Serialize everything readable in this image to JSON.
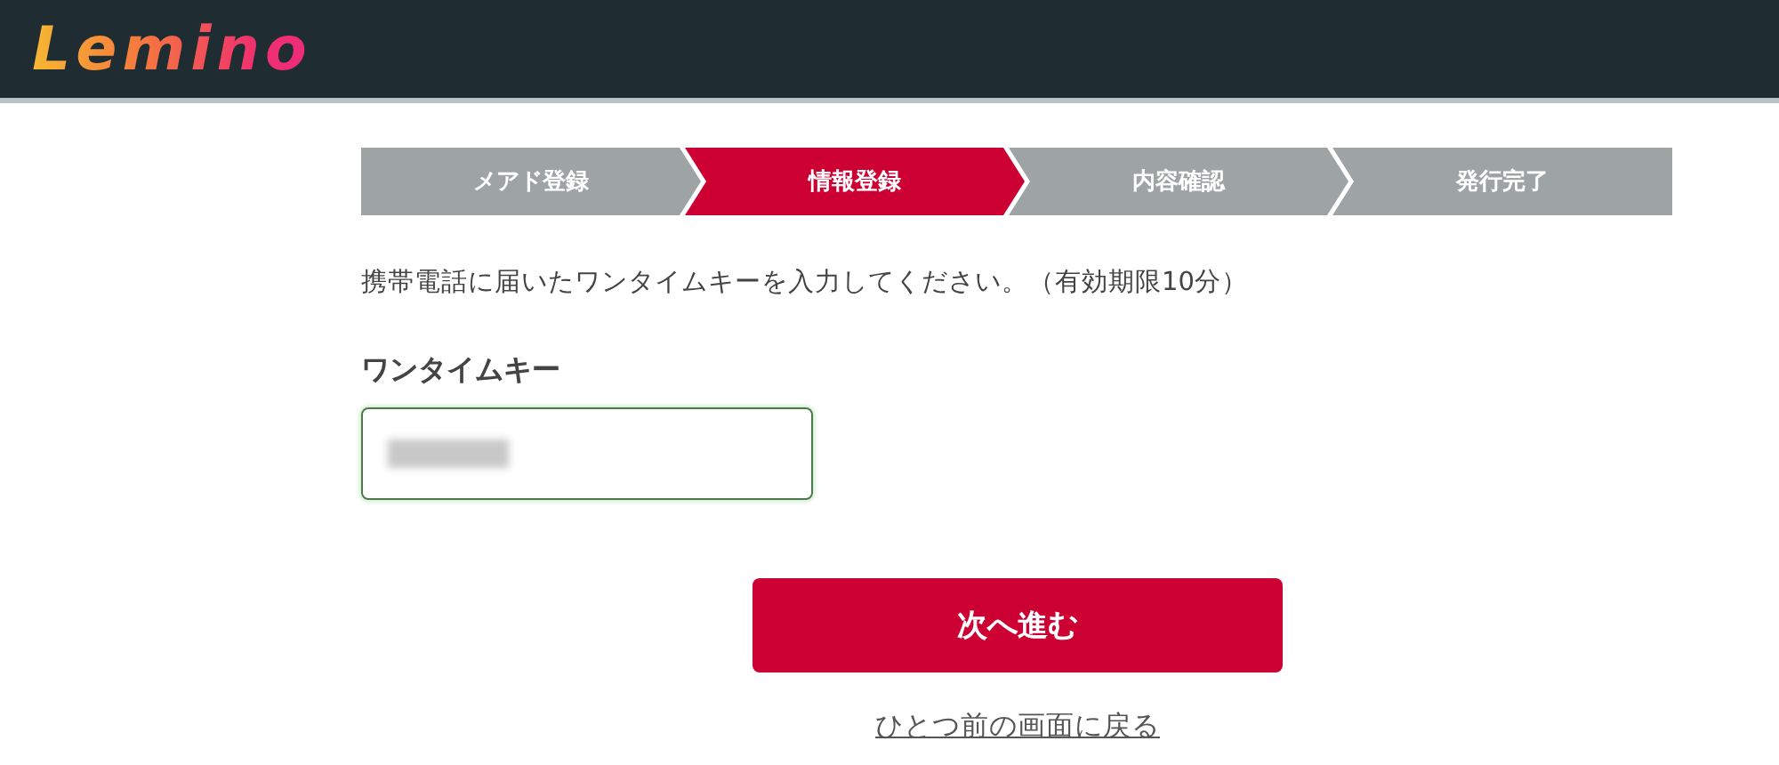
{
  "header": {
    "logo": "Lemino"
  },
  "steps": [
    {
      "label": "メアド登録",
      "selected": false
    },
    {
      "label": "情報登録",
      "selected": true
    },
    {
      "label": "内容確認",
      "selected": false
    },
    {
      "label": "発行完了",
      "selected": false
    }
  ],
  "instruction": "携帯電話に届いたワンタイムキーを入力してください。（有効期限10分）",
  "field": {
    "label": "ワンタイムキー",
    "redacted": true
  },
  "primary_button": "次へ進む",
  "back_link": "ひとつ前の画面に戻る"
}
